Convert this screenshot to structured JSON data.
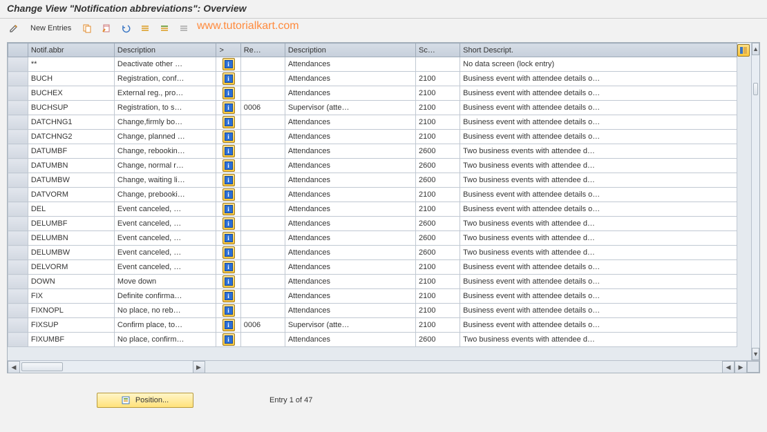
{
  "title": "Change View \"Notification abbreviations\": Overview",
  "toolbar": {
    "new_entries_label": "New Entries"
  },
  "watermark": "www.tutorialkart.com",
  "columns": {
    "abbr": "Notif.abbr",
    "desc1": "Description",
    "info": ">",
    "re": "Re…",
    "desc2": "Description",
    "sc": "Sc…",
    "short": "Short Descript."
  },
  "rows": [
    {
      "abbr": "**",
      "desc1": "Deactivate other …",
      "re": "",
      "desc2": "Attendances",
      "sc": "",
      "short": "No data screen (lock entry)"
    },
    {
      "abbr": "BUCH",
      "desc1": "Registration, conf…",
      "re": "",
      "desc2": "Attendances",
      "sc": "2100",
      "short": "Business event with attendee details o…"
    },
    {
      "abbr": "BUCHEX",
      "desc1": "External reg., pro…",
      "re": "",
      "desc2": "Attendances",
      "sc": "2100",
      "short": "Business event with attendee details o…"
    },
    {
      "abbr": "BUCHSUP",
      "desc1": "Registration, to s…",
      "re": "0006",
      "desc2": "Supervisor (atte…",
      "sc": "2100",
      "short": "Business event with attendee details o…"
    },
    {
      "abbr": "DATCHNG1",
      "desc1": "Change,firmly bo…",
      "re": "",
      "desc2": "Attendances",
      "sc": "2100",
      "short": "Business event with attendee details o…"
    },
    {
      "abbr": "DATCHNG2",
      "desc1": "Change, planned …",
      "re": "",
      "desc2": "Attendances",
      "sc": "2100",
      "short": "Business event with attendee details o…"
    },
    {
      "abbr": "DATUMBF",
      "desc1": "Change, rebookin…",
      "re": "",
      "desc2": "Attendances",
      "sc": "2600",
      "short": "Two business events with attendee d…"
    },
    {
      "abbr": "DATUMBN",
      "desc1": "Change, normal r…",
      "re": "",
      "desc2": "Attendances",
      "sc": "2600",
      "short": "Two business events with attendee d…"
    },
    {
      "abbr": "DATUMBW",
      "desc1": "Change, waiting li…",
      "re": "",
      "desc2": "Attendances",
      "sc": "2600",
      "short": "Two business events with attendee d…"
    },
    {
      "abbr": "DATVORM",
      "desc1": "Change, prebooki…",
      "re": "",
      "desc2": "Attendances",
      "sc": "2100",
      "short": "Business event with attendee details o…"
    },
    {
      "abbr": "DEL",
      "desc1": "Event canceled, …",
      "re": "",
      "desc2": "Attendances",
      "sc": "2100",
      "short": "Business event with attendee details o…"
    },
    {
      "abbr": "DELUMBF",
      "desc1": "Event canceled, …",
      "re": "",
      "desc2": "Attendances",
      "sc": "2600",
      "short": "Two business events with attendee d…"
    },
    {
      "abbr": "DELUMBN",
      "desc1": "Event canceled, …",
      "re": "",
      "desc2": "Attendances",
      "sc": "2600",
      "short": "Two business events with attendee d…"
    },
    {
      "abbr": "DELUMBW",
      "desc1": "Event canceled, …",
      "re": "",
      "desc2": "Attendances",
      "sc": "2600",
      "short": "Two business events with attendee d…"
    },
    {
      "abbr": "DELVORM",
      "desc1": "Event canceled, …",
      "re": "",
      "desc2": "Attendances",
      "sc": "2100",
      "short": "Business event with attendee details o…"
    },
    {
      "abbr": "DOWN",
      "desc1": "Move down",
      "re": "",
      "desc2": "Attendances",
      "sc": "2100",
      "short": "Business event with attendee details o…"
    },
    {
      "abbr": "FIX",
      "desc1": "Definite confirma…",
      "re": "",
      "desc2": "Attendances",
      "sc": "2100",
      "short": "Business event with attendee details o…"
    },
    {
      "abbr": "FIXNOPL",
      "desc1": "No place, no reb…",
      "re": "",
      "desc2": "Attendances",
      "sc": "2100",
      "short": "Business event with attendee details o…"
    },
    {
      "abbr": "FIXSUP",
      "desc1": "Confirm place, to…",
      "re": "0006",
      "desc2": "Supervisor (atte…",
      "sc": "2100",
      "short": "Business event with attendee details o…"
    },
    {
      "abbr": "FIXUMBF",
      "desc1": "No place, confirm…",
      "re": "",
      "desc2": "Attendances",
      "sc": "2600",
      "short": "Two business events with attendee d…"
    }
  ],
  "footer": {
    "position_label": "Position...",
    "entry_text": "Entry 1 of 47"
  }
}
